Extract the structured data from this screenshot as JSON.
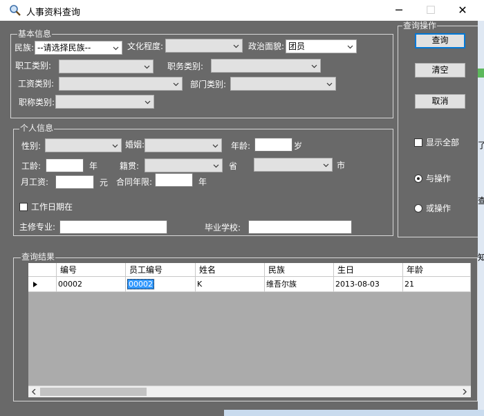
{
  "window": {
    "title": "人事资料查询",
    "minimize": "─",
    "maximize": "☐",
    "close": "✕"
  },
  "basic": {
    "legend": "基本信息",
    "ethnic_label": "民族:",
    "ethnic_value": "--请选择民族--",
    "education_label": "文化程度:",
    "education_value": "",
    "political_label": "政治面貌:",
    "political_value": "团员",
    "staff_type_label": "职工类别:",
    "staff_type_value": "",
    "duty_type_label": "职务类别:",
    "duty_type_value": "",
    "wage_type_label": "工资类别:",
    "wage_type_value": "",
    "dept_type_label": "部门类别:",
    "dept_type_value": "",
    "title_type_label": "职称类别:",
    "title_type_value": ""
  },
  "personal": {
    "legend": "个人信息",
    "gender_label": "性别:",
    "marriage_label": "婚姻:",
    "age_label": "年龄:",
    "age_unit": "岁",
    "seniority_label": "工龄:",
    "seniority_unit": "年",
    "native_label": "籍贯:",
    "province_unit": "省",
    "city_unit": "市",
    "monthly_wage_label": "月工资:",
    "monthly_wage_unit": "元",
    "contract_label": "合同年限:",
    "contract_unit": "年",
    "work_date_label": "工作日期在",
    "major_label": "主修专业:",
    "school_label": "毕业学校:"
  },
  "ops": {
    "legend": "查询操作",
    "query": "查询",
    "clear": "清空",
    "cancel": "取消",
    "show_all": "显示全部",
    "and_op": "与操作",
    "or_op": "或操作"
  },
  "results": {
    "legend": "查询结果",
    "columns": [
      "编号",
      "员工编号",
      "姓名",
      "民族",
      "生日",
      "年龄"
    ],
    "rows": [
      [
        "00002",
        "00002",
        "K",
        "维吾尔族",
        "2013-08-03",
        "21"
      ]
    ]
  },
  "edge_text": [
    "了",
    "查",
    "知"
  ]
}
